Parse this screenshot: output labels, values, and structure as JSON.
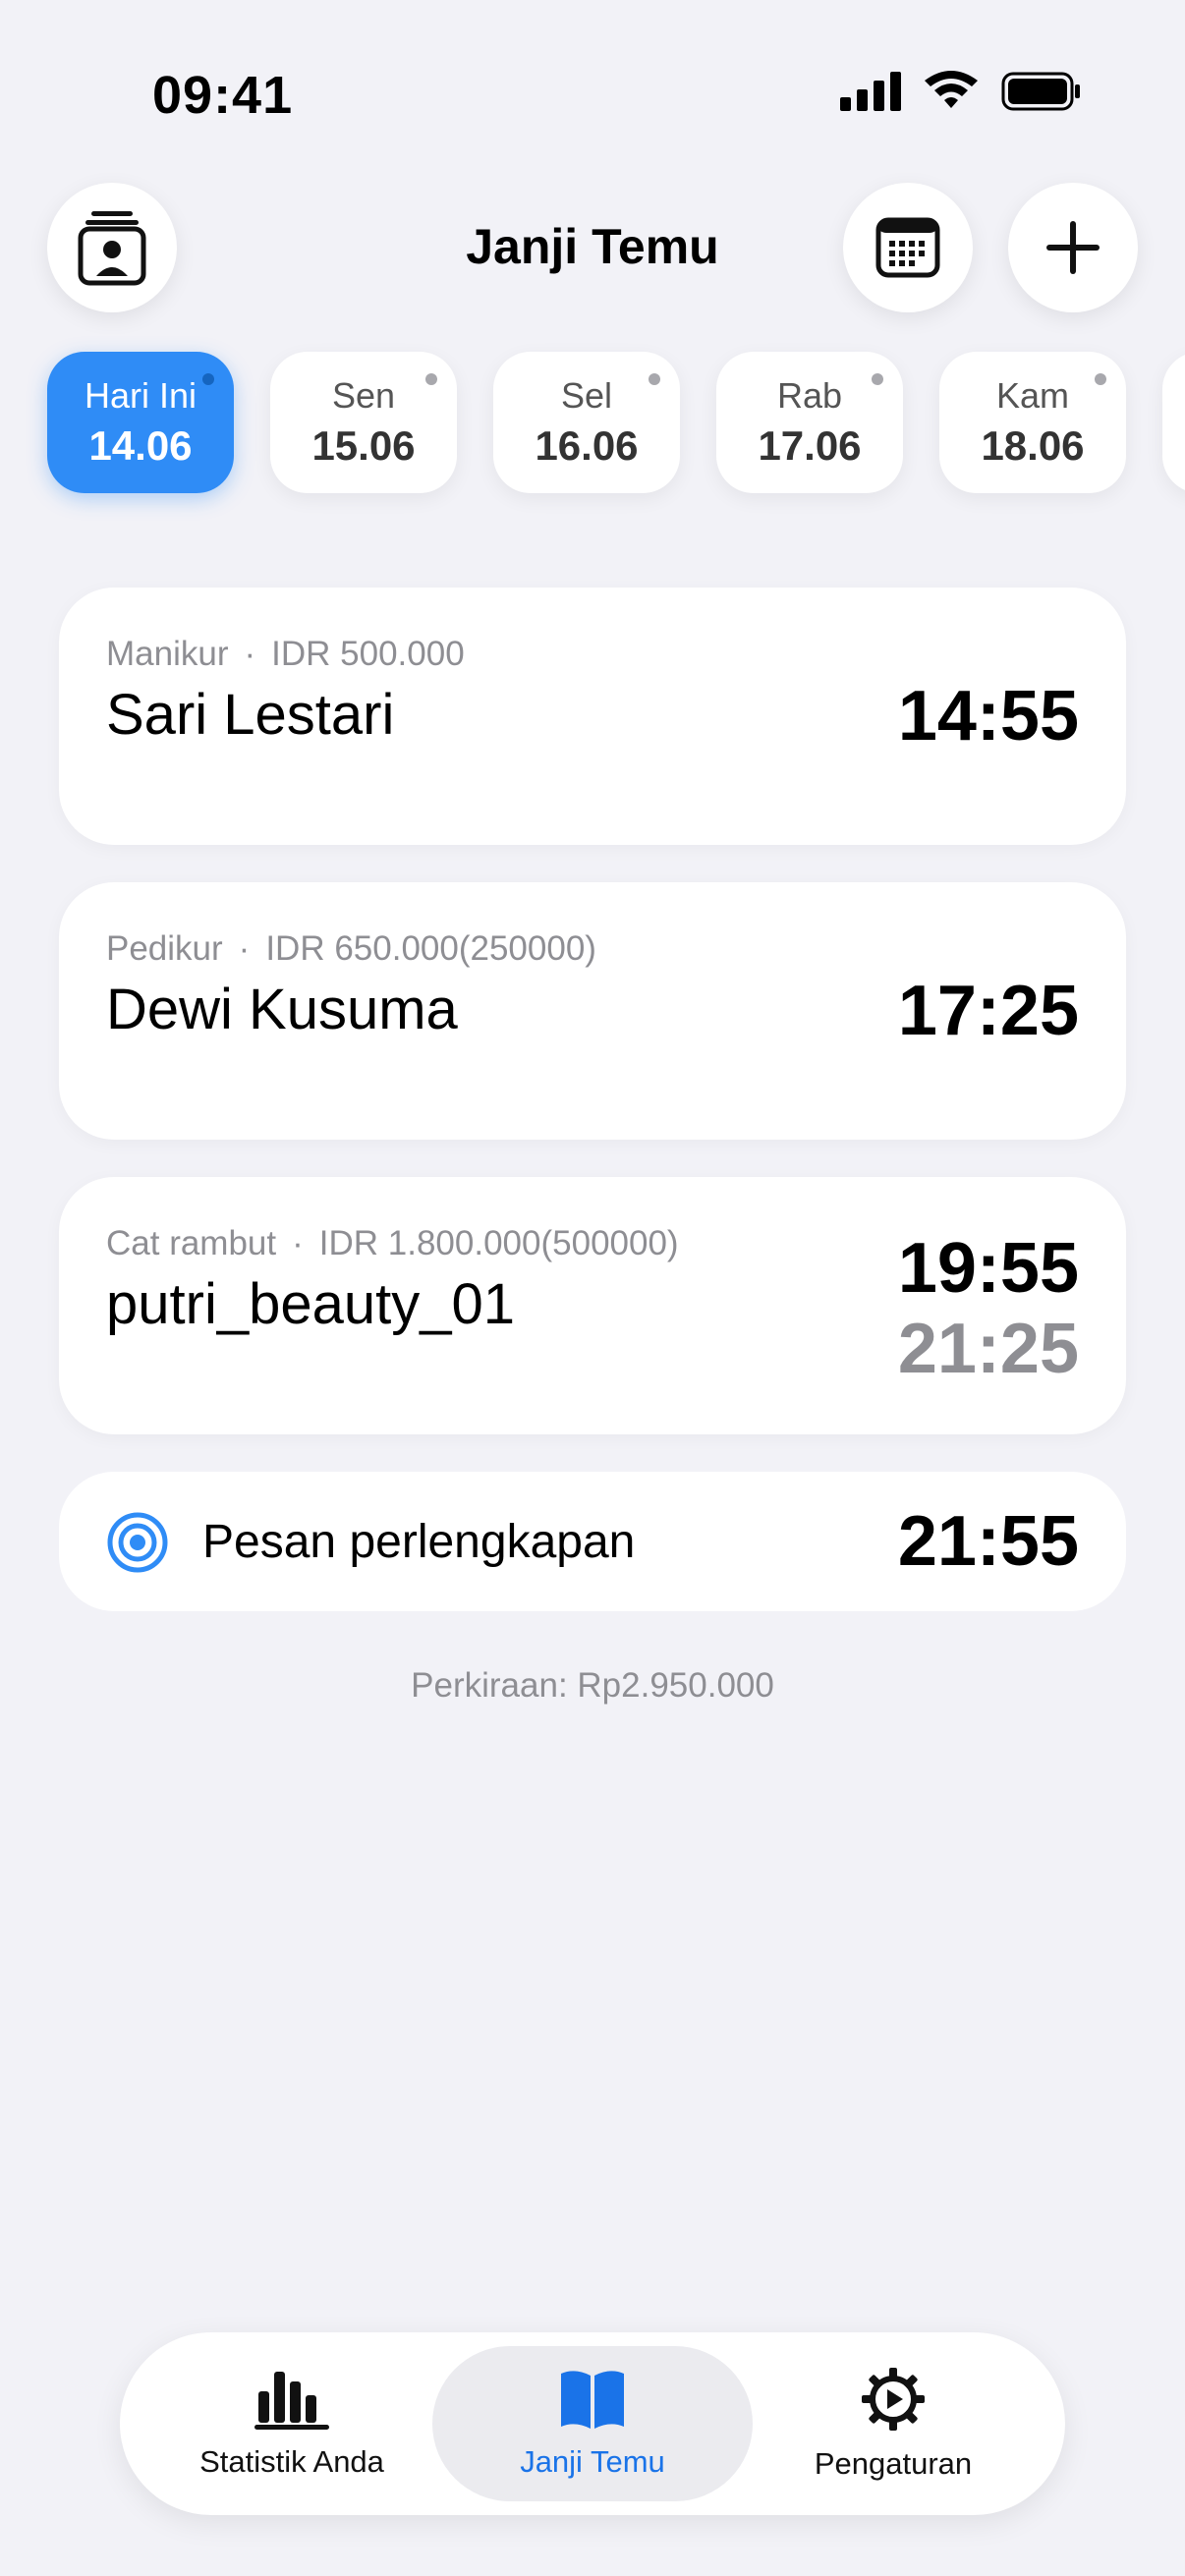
{
  "status": {
    "time": "09:41"
  },
  "header": {
    "title": "Janji Temu"
  },
  "days": [
    {
      "name": "Hari Ini",
      "date": "14.06",
      "active": true
    },
    {
      "name": "Sen",
      "date": "15.06"
    },
    {
      "name": "Sel",
      "date": "16.06"
    },
    {
      "name": "Rab",
      "date": "17.06"
    },
    {
      "name": "Kam",
      "date": "18.06"
    }
  ],
  "appointments": [
    {
      "service": "Manikur",
      "price": "IDR 500.000",
      "client": "Sari Lestari",
      "time": "14:55"
    },
    {
      "service": "Pedikur",
      "price": "IDR 650.000(250000)",
      "client": "Dewi Kusuma",
      "time": "17:25"
    },
    {
      "service": "Cat rambut",
      "price": "IDR 1.800.000(500000)",
      "client": "putri_beauty_01",
      "time": "19:55",
      "end_time": "21:25"
    }
  ],
  "task": {
    "label": "Pesan perlengkapan",
    "time": "21:55"
  },
  "estimate": "Perkiraan: Rp2.950.000",
  "tabs": [
    {
      "label": "Statistik Anda",
      "icon": "bar-chart-icon"
    },
    {
      "label": "Janji Temu",
      "icon": "book-icon",
      "active": true
    },
    {
      "label": "Pengaturan",
      "icon": "gear-icon"
    }
  ],
  "colors": {
    "accent": "#2f8cf6",
    "tab_active": "#1a73e8",
    "muted": "#8e8e93"
  }
}
